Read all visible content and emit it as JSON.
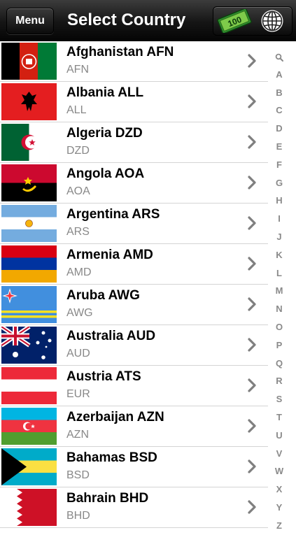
{
  "navbar": {
    "menu_label": "Menu",
    "title": "Select Country",
    "money_icon": "money-bills-icon",
    "money_label": "100",
    "globe_icon": "globe-icon"
  },
  "countries": [
    {
      "name": "Afghanistan AFN",
      "code": "AFN",
      "flag": "afghanistan-flag"
    },
    {
      "name": "Albania ALL",
      "code": "ALL",
      "flag": "albania-flag"
    },
    {
      "name": "Algeria DZD",
      "code": "DZD",
      "flag": "algeria-flag"
    },
    {
      "name": "Angola AOA",
      "code": "AOA",
      "flag": "angola-flag"
    },
    {
      "name": "Argentina ARS",
      "code": "ARS",
      "flag": "argentina-flag"
    },
    {
      "name": "Armenia AMD",
      "code": "AMD",
      "flag": "armenia-flag"
    },
    {
      "name": "Aruba AWG",
      "code": "AWG",
      "flag": "aruba-flag"
    },
    {
      "name": "Australia AUD",
      "code": "AUD",
      "flag": "australia-flag"
    },
    {
      "name": "Austria ATS",
      "code": "EUR",
      "flag": "austria-flag"
    },
    {
      "name": "Azerbaijan AZN",
      "code": "AZN",
      "flag": "azerbaijan-flag"
    },
    {
      "name": "Bahamas BSD",
      "code": "BSD",
      "flag": "bahamas-flag"
    },
    {
      "name": "Bahrain BHD",
      "code": "BHD",
      "flag": "bahrain-flag"
    }
  ],
  "index_letters": [
    "A",
    "B",
    "C",
    "D",
    "E",
    "F",
    "G",
    "H",
    "I",
    "J",
    "K",
    "L",
    "M",
    "N",
    "O",
    "P",
    "Q",
    "R",
    "S",
    "T",
    "U",
    "V",
    "W",
    "X",
    "Y",
    "Z"
  ],
  "index_search_icon": "search-icon",
  "row_chevron_icon": "chevron-right-icon",
  "colors": {
    "navbar": "#111111",
    "name_text": "#000000",
    "code_text": "#888888",
    "index_text": "#8a8a8a",
    "separator": "#d4d4d4"
  }
}
